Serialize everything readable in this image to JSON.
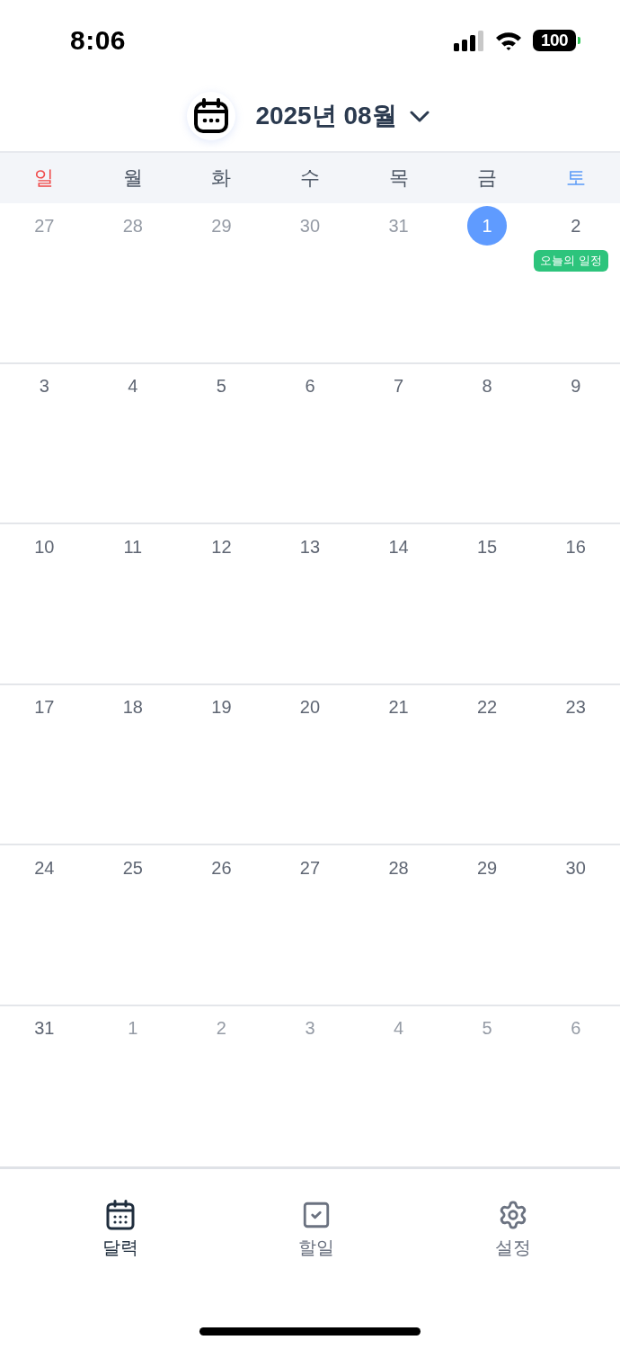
{
  "status_bar": {
    "time": "8:06",
    "battery": "100"
  },
  "header": {
    "title": "2025년 08월"
  },
  "weekdays": [
    {
      "label": "일",
      "kind": "sunday"
    },
    {
      "label": "월",
      "kind": "weekday"
    },
    {
      "label": "화",
      "kind": "weekday"
    },
    {
      "label": "수",
      "kind": "weekday"
    },
    {
      "label": "목",
      "kind": "weekday"
    },
    {
      "label": "금",
      "kind": "weekday"
    },
    {
      "label": "토",
      "kind": "saturday"
    }
  ],
  "weeks": [
    [
      {
        "day": "27",
        "in_month": false,
        "selected": false
      },
      {
        "day": "28",
        "in_month": false,
        "selected": false
      },
      {
        "day": "29",
        "in_month": false,
        "selected": false
      },
      {
        "day": "30",
        "in_month": false,
        "selected": false
      },
      {
        "day": "31",
        "in_month": false,
        "selected": false
      },
      {
        "day": "1",
        "in_month": true,
        "selected": true
      },
      {
        "day": "2",
        "in_month": true,
        "selected": false,
        "events": [
          {
            "title": "오늘의 일정"
          }
        ]
      }
    ],
    [
      {
        "day": "3",
        "in_month": true,
        "selected": false
      },
      {
        "day": "4",
        "in_month": true,
        "selected": false
      },
      {
        "day": "5",
        "in_month": true,
        "selected": false
      },
      {
        "day": "6",
        "in_month": true,
        "selected": false
      },
      {
        "day": "7",
        "in_month": true,
        "selected": false
      },
      {
        "day": "8",
        "in_month": true,
        "selected": false
      },
      {
        "day": "9",
        "in_month": true,
        "selected": false
      }
    ],
    [
      {
        "day": "10",
        "in_month": true,
        "selected": false
      },
      {
        "day": "11",
        "in_month": true,
        "selected": false
      },
      {
        "day": "12",
        "in_month": true,
        "selected": false
      },
      {
        "day": "13",
        "in_month": true,
        "selected": false
      },
      {
        "day": "14",
        "in_month": true,
        "selected": false
      },
      {
        "day": "15",
        "in_month": true,
        "selected": false
      },
      {
        "day": "16",
        "in_month": true,
        "selected": false
      }
    ],
    [
      {
        "day": "17",
        "in_month": true,
        "selected": false
      },
      {
        "day": "18",
        "in_month": true,
        "selected": false
      },
      {
        "day": "19",
        "in_month": true,
        "selected": false
      },
      {
        "day": "20",
        "in_month": true,
        "selected": false
      },
      {
        "day": "21",
        "in_month": true,
        "selected": false
      },
      {
        "day": "22",
        "in_month": true,
        "selected": false
      },
      {
        "day": "23",
        "in_month": true,
        "selected": false
      }
    ],
    [
      {
        "day": "24",
        "in_month": true,
        "selected": false
      },
      {
        "day": "25",
        "in_month": true,
        "selected": false
      },
      {
        "day": "26",
        "in_month": true,
        "selected": false
      },
      {
        "day": "27",
        "in_month": true,
        "selected": false
      },
      {
        "day": "28",
        "in_month": true,
        "selected": false
      },
      {
        "day": "29",
        "in_month": true,
        "selected": false
      },
      {
        "day": "30",
        "in_month": true,
        "selected": false
      }
    ],
    [
      {
        "day": "31",
        "in_month": true,
        "selected": false
      },
      {
        "day": "1",
        "in_month": false,
        "selected": false
      },
      {
        "day": "2",
        "in_month": false,
        "selected": false
      },
      {
        "day": "3",
        "in_month": false,
        "selected": false
      },
      {
        "day": "4",
        "in_month": false,
        "selected": false
      },
      {
        "day": "5",
        "in_month": false,
        "selected": false
      },
      {
        "day": "6",
        "in_month": false,
        "selected": false
      }
    ]
  ],
  "tabs": [
    {
      "label": "달력",
      "kind": "calendar",
      "selected": true
    },
    {
      "label": "할일",
      "kind": "todo",
      "selected": false
    },
    {
      "label": "설정",
      "kind": "settings",
      "selected": false
    }
  ]
}
